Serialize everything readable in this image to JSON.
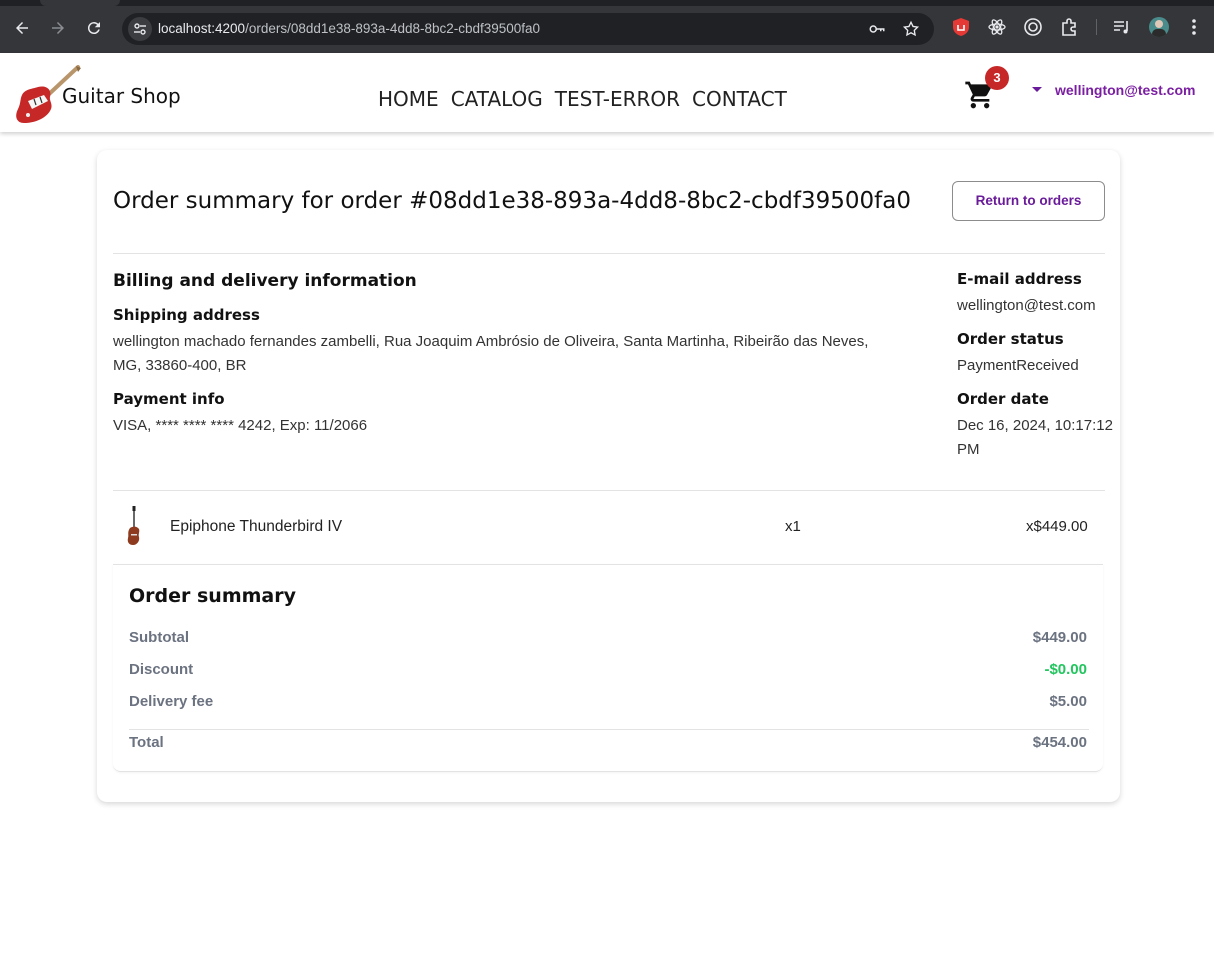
{
  "browser": {
    "url_host": "localhost:4200",
    "url_path": "/orders/08dd1e38-893a-4dd8-8bc2-cbdf39500fa0"
  },
  "header": {
    "brand": "Guitar Shop",
    "nav": [
      "HOME",
      "CATALOG",
      "TEST-ERROR",
      "CONTACT"
    ],
    "cart_count": "3",
    "user_email": "wellington@test.com",
    "colors": {
      "accent": "#7b1fa2",
      "badge": "#c62828"
    }
  },
  "order": {
    "title": "Order summary for order #08dd1e38-893a-4dd8-8bc2-cbdf39500fa0",
    "return_label": "Return to orders",
    "billing_heading": "Billing and delivery information",
    "shipping_label": "Shipping address",
    "shipping_value": "wellington machado fernandes zambelli, Rua Joaquim Ambrósio de Oliveira, Santa Martinha, Ribeirão das Neves, MG, 33860-400, BR",
    "payment_label": "Payment info",
    "payment_value": "VISA, **** **** **** 4242, Exp: 11/2066",
    "email_label": "E-mail address",
    "email_value": "wellington@test.com",
    "status_label": "Order status",
    "status_value": "PaymentReceived",
    "date_label": "Order date",
    "date_value": "Dec 16, 2024, 10:17:12 PM",
    "items": [
      {
        "name": "Epiphone Thunderbird IV",
        "qty": "x1",
        "price": "x$449.00"
      }
    ]
  },
  "summary": {
    "title": "Order summary",
    "subtotal_label": "Subtotal",
    "subtotal_value": "$449.00",
    "discount_label": "Discount",
    "discount_value": "-$0.00",
    "delivery_label": "Delivery fee",
    "delivery_value": "$5.00",
    "total_label": "Total",
    "total_value": "$454.00",
    "colors": {
      "discount": "#22c55e",
      "muted": "#6b7280"
    }
  }
}
